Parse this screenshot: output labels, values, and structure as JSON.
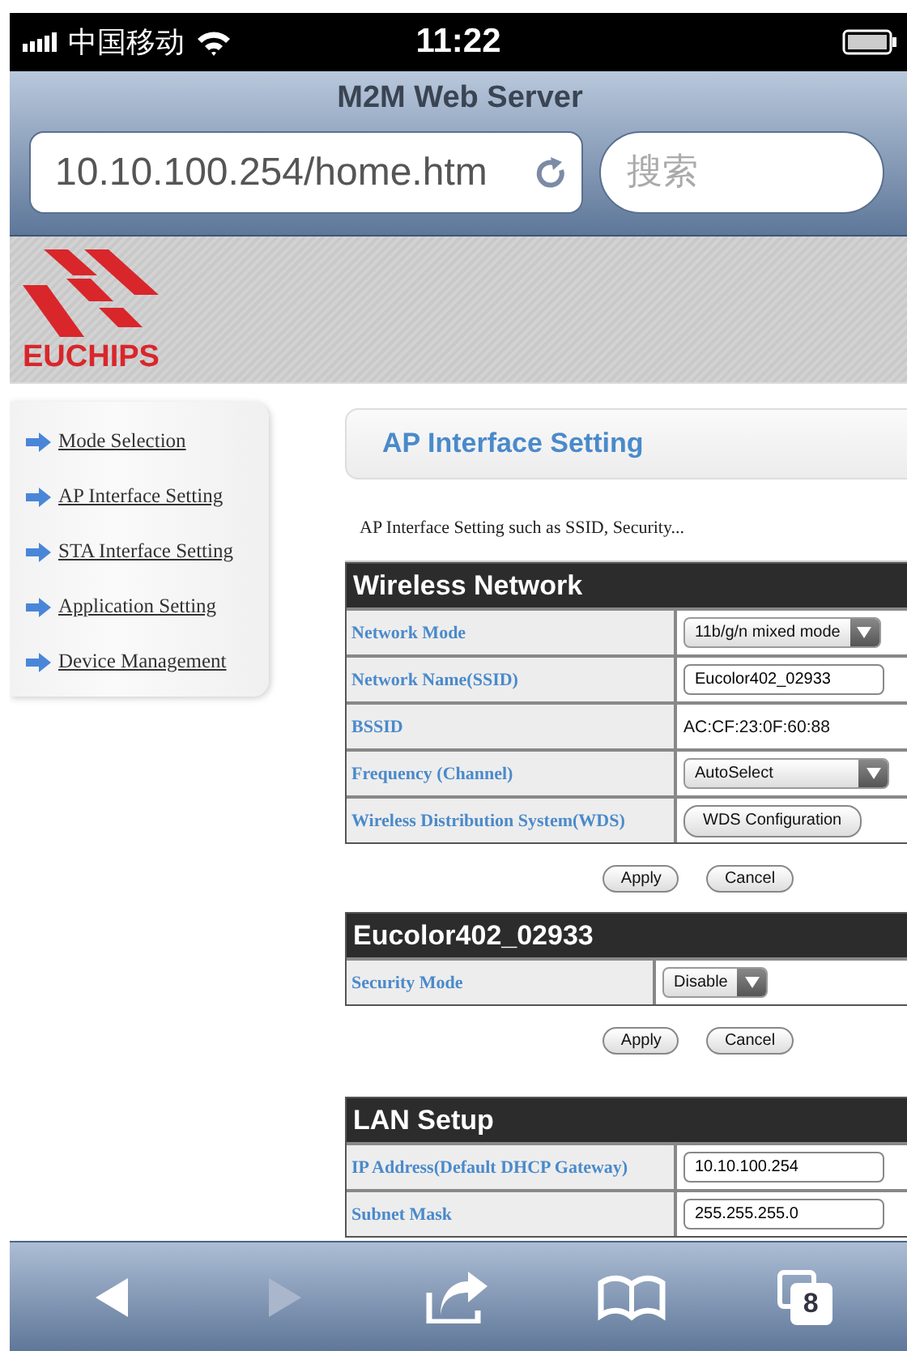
{
  "status_bar": {
    "carrier": "中国移动",
    "time": "11:22"
  },
  "browser": {
    "title": "M2M Web Server",
    "url": "10.10.100.254/home.htm",
    "search": {
      "placeholder": "搜索"
    }
  },
  "banner": {
    "logo_text": "EUCHIPS"
  },
  "sidebar": {
    "items": [
      {
        "label": "Mode Selection"
      },
      {
        "label": "AP Interface Setting"
      },
      {
        "label": "STA Interface Setting"
      },
      {
        "label": "Application Setting"
      },
      {
        "label": "Device Management"
      }
    ]
  },
  "page_title": "AP Interface Setting",
  "description": "AP Interface Setting such as SSID, Security...",
  "sections": [
    {
      "title": "Wireless Network",
      "rows": [
        {
          "label": "Network Mode",
          "kind": "select",
          "value": "11b/g/n mixed mode"
        },
        {
          "label": "Network Name(SSID)",
          "kind": "input",
          "value": "Eucolor402_02933"
        },
        {
          "label": "BSSID",
          "kind": "static",
          "value": "AC:CF:23:0F:60:88"
        },
        {
          "label": "Frequency (Channel)",
          "kind": "select",
          "value": "AutoSelect"
        },
        {
          "label": "Wireless Distribution System(WDS)",
          "kind": "button",
          "value": "WDS Configuration"
        }
      ],
      "buttons": [
        "Apply",
        "Cancel"
      ]
    },
    {
      "title": "Eucolor402_02933",
      "rows": [
        {
          "label": "Security Mode",
          "kind": "select",
          "value": "Disable"
        }
      ],
      "buttons": [
        "Apply",
        "Cancel"
      ]
    },
    {
      "title": "LAN Setup",
      "rows": [
        {
          "label": "IP Address(Default DHCP Gateway)",
          "kind": "input",
          "value": "10.10.100.254"
        },
        {
          "label": "Subnet Mask",
          "kind": "input",
          "value": "255.255.255.0"
        }
      ]
    }
  ],
  "toolbar": [
    {
      "kind": "back",
      "disabled": false
    },
    {
      "kind": "forward",
      "disabled": true
    },
    {
      "kind": "share",
      "disabled": false
    },
    {
      "kind": "bookmarks",
      "disabled": false
    },
    {
      "kind": "tabs",
      "disabled": false,
      "count": "8"
    }
  ]
}
